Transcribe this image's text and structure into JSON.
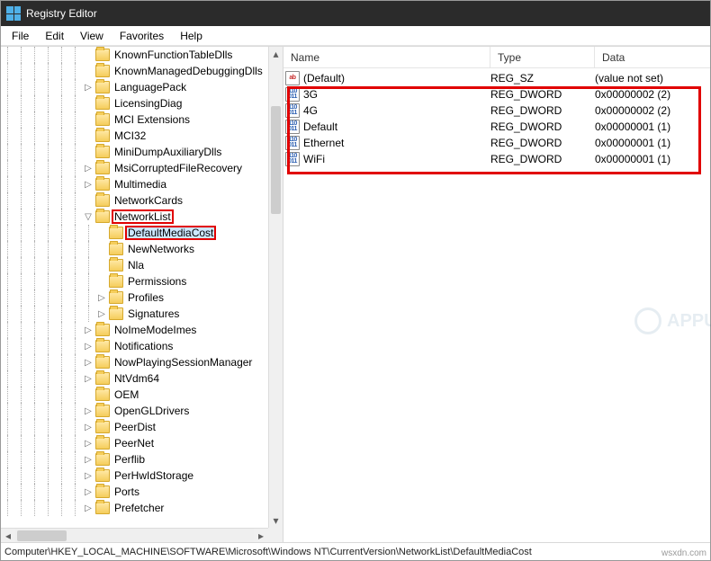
{
  "title": "Registry Editor",
  "menu": [
    "File",
    "Edit",
    "View",
    "Favorites",
    "Help"
  ],
  "tree": [
    {
      "d": 6,
      "e": "",
      "l": "KnownFunctionTableDlls"
    },
    {
      "d": 6,
      "e": "",
      "l": "KnownManagedDebuggingDlls"
    },
    {
      "d": 6,
      "e": ">",
      "l": "LanguagePack"
    },
    {
      "d": 6,
      "e": "",
      "l": "LicensingDiag"
    },
    {
      "d": 6,
      "e": "",
      "l": "MCI Extensions"
    },
    {
      "d": 6,
      "e": "",
      "l": "MCI32"
    },
    {
      "d": 6,
      "e": "",
      "l": "MiniDumpAuxiliaryDlls"
    },
    {
      "d": 6,
      "e": ">",
      "l": "MsiCorruptedFileRecovery"
    },
    {
      "d": 6,
      "e": ">",
      "l": "Multimedia"
    },
    {
      "d": 6,
      "e": "",
      "l": "NetworkCards"
    },
    {
      "d": 6,
      "e": "v",
      "l": "NetworkList",
      "hl": true
    },
    {
      "d": 7,
      "e": "",
      "l": "DefaultMediaCost",
      "sel": true,
      "hl": true
    },
    {
      "d": 7,
      "e": "",
      "l": "NewNetworks"
    },
    {
      "d": 7,
      "e": "",
      "l": "Nla"
    },
    {
      "d": 7,
      "e": "",
      "l": "Permissions"
    },
    {
      "d": 7,
      "e": ">",
      "l": "Profiles"
    },
    {
      "d": 7,
      "e": ">",
      "l": "Signatures"
    },
    {
      "d": 6,
      "e": ">",
      "l": "NoImeModeImes"
    },
    {
      "d": 6,
      "e": ">",
      "l": "Notifications"
    },
    {
      "d": 6,
      "e": ">",
      "l": "NowPlayingSessionManager"
    },
    {
      "d": 6,
      "e": ">",
      "l": "NtVdm64"
    },
    {
      "d": 6,
      "e": "",
      "l": "OEM"
    },
    {
      "d": 6,
      "e": ">",
      "l": "OpenGLDrivers"
    },
    {
      "d": 6,
      "e": ">",
      "l": "PeerDist"
    },
    {
      "d": 6,
      "e": ">",
      "l": "PeerNet"
    },
    {
      "d": 6,
      "e": ">",
      "l": "Perflib"
    },
    {
      "d": 6,
      "e": ">",
      "l": "PerHwIdStorage"
    },
    {
      "d": 6,
      "e": ">",
      "l": "Ports"
    },
    {
      "d": 6,
      "e": ">",
      "l": "Prefetcher"
    }
  ],
  "columns": {
    "name": "Name",
    "type": "Type",
    "data": "Data"
  },
  "values": [
    {
      "icon": "sz",
      "name": "(Default)",
      "type": "REG_SZ",
      "data": "(value not set)"
    },
    {
      "icon": "dw",
      "name": "3G",
      "type": "REG_DWORD",
      "data": "0x00000002 (2)"
    },
    {
      "icon": "dw",
      "name": "4G",
      "type": "REG_DWORD",
      "data": "0x00000002 (2)"
    },
    {
      "icon": "dw",
      "name": "Default",
      "type": "REG_DWORD",
      "data": "0x00000001 (1)"
    },
    {
      "icon": "dw",
      "name": "Ethernet",
      "type": "REG_DWORD",
      "data": "0x00000001 (1)"
    },
    {
      "icon": "dw",
      "name": "WiFi",
      "type": "REG_DWORD",
      "data": "0x00000001 (1)"
    }
  ],
  "statusbar": "Computer\\HKEY_LOCAL_MACHINE\\SOFTWARE\\Microsoft\\Windows NT\\CurrentVersion\\NetworkList\\DefaultMediaCost",
  "watermark": "wsxdn.com",
  "brand": "APPUALS"
}
